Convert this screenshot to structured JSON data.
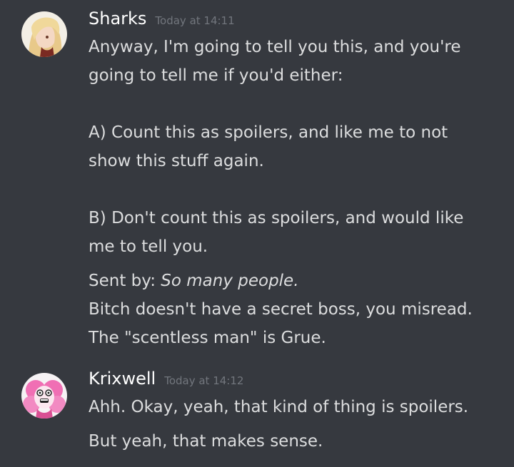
{
  "messages": [
    {
      "username": "Sharks",
      "timestamp": "Today at 14:11",
      "avatar": "blonde-anime-character-avatar",
      "lines": {
        "l1": "Anyway, I'm going to tell you this, and you're",
        "l2": "going to tell me if you'd either:",
        "l3": "A) Count this as spoilers, and like me to not",
        "l4": "show this stuff again.",
        "l5": "B) Don't count this as spoilers, and would like",
        "l6": "me to tell you.",
        "l7_prefix": "Sent by: ",
        "l7_italic": "So many people.",
        "l8": "Bitch doesn't have a secret boss, you misread.",
        "l9": "The \"scentless man\" is Grue."
      }
    },
    {
      "username": "Krixwell",
      "timestamp": "Today at 14:12",
      "avatar": "pink-cartoon-character-avatar",
      "lines": {
        "l1": "Ahh. Okay, yeah, that kind of thing is spoilers.",
        "l2": "But yeah, that makes sense."
      }
    }
  ],
  "colors": {
    "background": "#36393f",
    "username": "#ffffff",
    "text": "#dcddde",
    "timestamp": "#72767d"
  }
}
